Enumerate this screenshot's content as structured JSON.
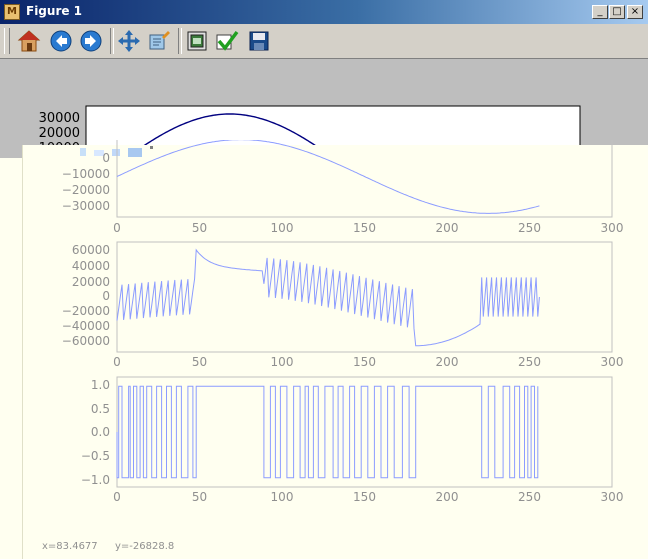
{
  "window": {
    "title": "Figure 1",
    "controls": {
      "minimize": "_",
      "maximize": "□",
      "close": "×"
    }
  },
  "toolbar": {
    "buttons": [
      {
        "name": "home-button",
        "icon": "home-icon",
        "label": ""
      },
      {
        "name": "back-button",
        "icon": "back-arrow-icon",
        "label": ""
      },
      {
        "name": "forward-button",
        "icon": "forward-arrow-icon",
        "label": ""
      },
      {
        "name": "pan-button",
        "icon": "pan-move-icon",
        "label": ""
      },
      {
        "name": "zoom-button",
        "icon": "zoom-rect-icon",
        "label": ""
      },
      {
        "name": "subplots-button",
        "icon": "subplots-config-icon",
        "label": ""
      },
      {
        "name": "apply-button",
        "icon": "checkmark-icon",
        "label": ""
      },
      {
        "name": "save-button",
        "icon": "save-floppy-icon",
        "label": ""
      }
    ]
  },
  "status": {
    "x_readout": "x=83.4677",
    "y_readout": "y=-26828.8"
  },
  "colors": {
    "background_plot": "#bebebe",
    "overlay_plot": "#fffff0",
    "top_line": "#000080",
    "line": "#8c9cff",
    "axis": "#c0c0c0",
    "text_dark": "#000000",
    "text_light": "#909090"
  },
  "chart_data": [
    {
      "type": "line",
      "role": "background-plot",
      "x": [
        0,
        255
      ],
      "xlim": [
        0,
        300
      ],
      "ylim": [
        -32767,
        32767
      ],
      "yticks": [
        "30000",
        "20000",
        "10000"
      ],
      "series": [
        {
          "shape": "sine",
          "amplitude": 32767,
          "period": 300
        }
      ]
    },
    {
      "type": "line",
      "role": "overlay-sine",
      "xlim": [
        0,
        300
      ],
      "xticks": [
        "0",
        "50",
        "100",
        "150",
        "200",
        "250",
        "300"
      ],
      "ylim": [
        -36000,
        36000
      ],
      "yticks": [
        "0",
        "−10000",
        "−20000",
        "−30000"
      ],
      "series": [
        {
          "shape": "sine",
          "amplitude": 32767,
          "period": 300,
          "x_end": 256
        }
      ]
    },
    {
      "type": "line",
      "role": "overlay-sawtooth",
      "xlim": [
        0,
        300
      ],
      "xticks": [
        "0",
        "50",
        "100",
        "150",
        "200",
        "250",
        "300"
      ],
      "ylim": [
        -70000,
        70000
      ],
      "yticks": [
        "60000",
        "40000",
        "20000",
        "0",
        "−20000",
        "−40000",
        "−60000"
      ]
    },
    {
      "type": "line",
      "role": "overlay-square",
      "xlim": [
        0,
        300
      ],
      "xticks": [
        "0",
        "50",
        "100",
        "150",
        "200",
        "250",
        "300"
      ],
      "ylim": [
        -1.2,
        1.2
      ],
      "yticks": [
        "1.0",
        "0.5",
        "0.0",
        "−0.5",
        "−1.0"
      ],
      "switch_points": [
        1,
        3,
        7,
        8,
        10,
        12,
        14,
        16,
        18,
        21,
        24,
        27,
        30,
        33,
        36,
        39,
        43,
        46,
        48,
        89,
        93,
        96,
        99,
        103,
        107,
        111,
        114,
        116,
        119,
        122,
        126,
        131,
        134,
        137,
        141,
        144,
        148,
        152,
        156,
        160,
        164,
        168,
        173,
        177,
        181,
        221,
        225,
        229,
        234,
        238,
        241,
        244,
        247,
        249,
        251,
        253,
        255
      ],
      "start_value": -1
    }
  ]
}
